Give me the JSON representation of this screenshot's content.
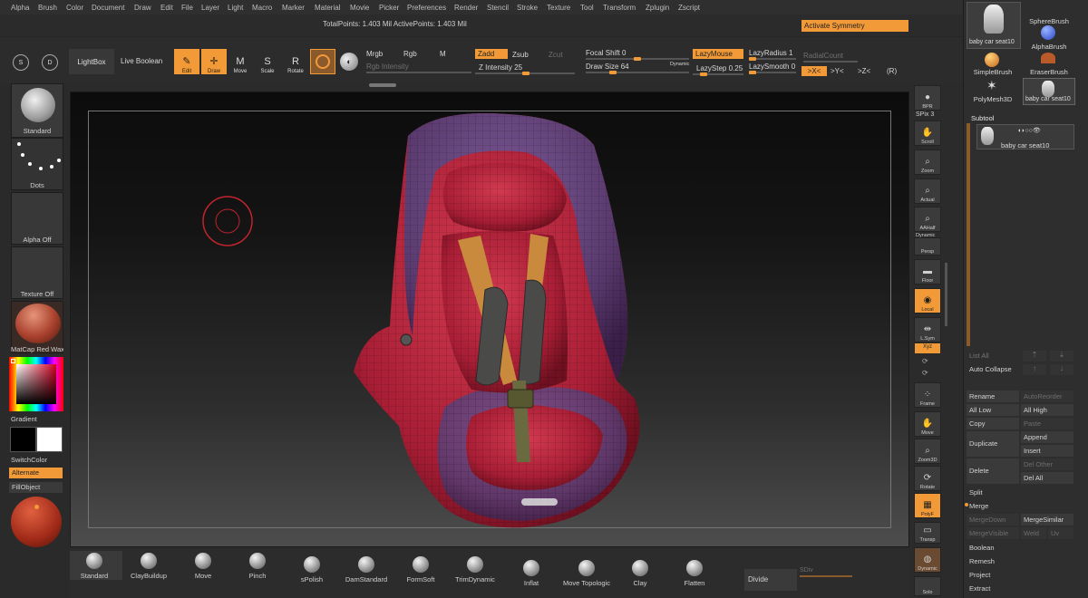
{
  "menu": [
    "Alpha",
    "Brush",
    "Color",
    "Document",
    "Draw",
    "Edit",
    "File",
    "Layer",
    "Light",
    "Macro",
    "Marker",
    "Material",
    "Movie",
    "Picker",
    "Preferences",
    "Render",
    "Stencil",
    "Stroke",
    "Texture",
    "Tool",
    "Transform",
    "Zplugin",
    "Zscript"
  ],
  "status": {
    "points": "TotalPoints: 1.403 Mil ActivePoints: 1.403 Mil",
    "activate_symmetry": "Activate Symmetry"
  },
  "shelf": {
    "lightbox": "LightBox",
    "live_boolean": "Live Boolean",
    "edit": "Edit",
    "draw": "Draw",
    "move": "Move",
    "scale": "Scale",
    "rotate": "Rotate",
    "mrgb": "Mrgb",
    "rgb": "Rgb",
    "m": "M",
    "rgb_intensity": "Rgb Intensity",
    "zadd": "Zadd",
    "zsub": "Zsub",
    "zcut": "Zcut",
    "z_intensity_label": "Z Intensity",
    "z_intensity_value": "25",
    "focal_shift_label": "Focal Shift",
    "focal_shift_value": "0",
    "draw_size_label": "Draw Size",
    "draw_size_value": "64",
    "dynamic": "Dynamic",
    "lazymouse": "LazyMouse",
    "lazystep_label": "LazyStep",
    "lazystep_value": "0.25",
    "lazyradius_label": "LazyRadius",
    "lazyradius_value": "1",
    "lazysmooth_label": "LazySmooth",
    "lazysmooth_value": "0",
    "radialcount": "RadialCount",
    "sym_x": ">X<",
    "sym_y": ">Y<",
    "sym_z": ">Z<",
    "sym_r": "(R)"
  },
  "left": {
    "brush": "Standard",
    "stroke": "Dots",
    "alpha": "Alpha Off",
    "texture": "Texture Off",
    "material": "MatCap Red Wax",
    "gradient": "Gradient",
    "switchcolor": "SwitchColor",
    "alternate": "Alternate",
    "fillobject": "FillObject"
  },
  "right_tools": [
    "BPR",
    "SPix 3",
    "Scroll",
    "Zoom",
    "Actual",
    "AAHalf",
    "Dynamic",
    "Persp",
    "Floor",
    "Local",
    "L.Sym",
    "Xyz",
    "Frame",
    "Move",
    "Zoom3D",
    "Rotate",
    "PolyF",
    "Transp",
    "Dynamic",
    "Solo"
  ],
  "tool_panel": {
    "current_tool": "baby car seat10",
    "sphere_brush": "SphereBrush",
    "alpha_brush": "AlphaBrush",
    "simple_brush": "SimpleBrush",
    "eraser_brush": "EraserBrush",
    "polymesh": "PolyMesh3D",
    "subtool_title": "Subtool",
    "subtool_item": "baby car seat10",
    "list_all": "List All",
    "auto_collapse": "Auto Collapse",
    "rename": "Rename",
    "autoreorder": "AutoReorder",
    "all_low": "All Low",
    "all_high": "All High",
    "copy": "Copy",
    "paste": "Paste",
    "duplicate": "Duplicate",
    "append": "Append",
    "insert": "Insert",
    "delete": "Delete",
    "del_other": "Del Other",
    "del_all": "Del All",
    "split": "Split",
    "merge": "Merge",
    "mergedown": "MergeDown",
    "mergesimilar": "MergeSimilar",
    "mergevisible": "MergeVisible",
    "weld": "Weld",
    "uv": "Uv",
    "boolean": "Boolean",
    "remesh": "Remesh",
    "project": "Project",
    "extract": "Extract"
  },
  "brushes": [
    "Standard",
    "ClayBuildup",
    "Move",
    "Pinch",
    "sPolish",
    "DamStandard",
    "FormSoft",
    "TrimDynamic",
    "Inflat",
    "Move Topologic",
    "Clay",
    "Flatten"
  ],
  "divide": "Divide",
  "sdiv": "SDiv",
  "colors": {
    "accent": "#f29a38",
    "seat_red": "#b0243a",
    "seat_purple": "#5a3a6e",
    "strap": "#c98a3e"
  }
}
